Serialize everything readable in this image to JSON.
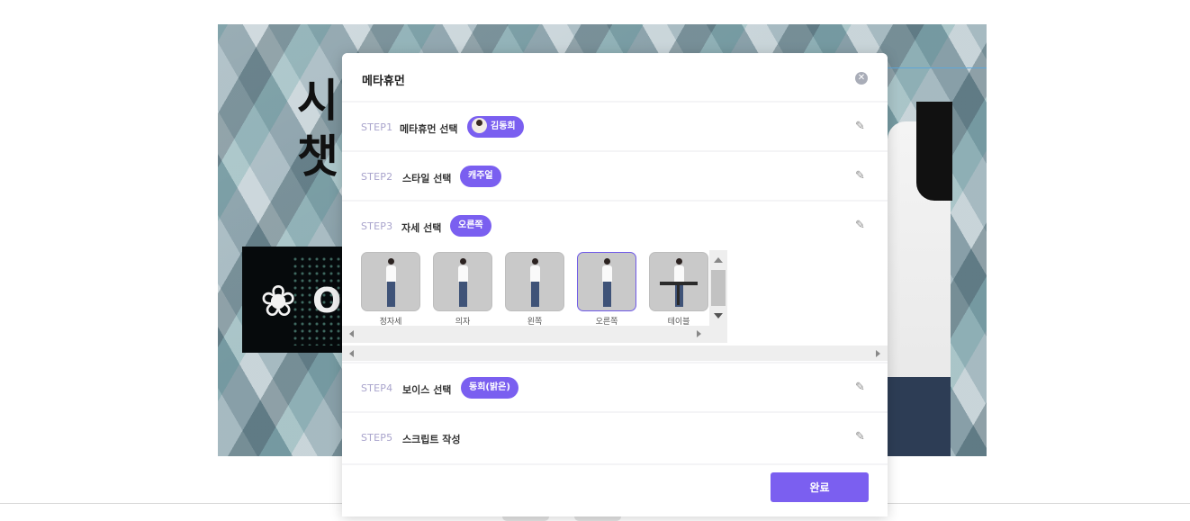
{
  "slide": {
    "title_line1": "시",
    "title_line2": "챗",
    "logo_text": "O"
  },
  "modal": {
    "title": "메타휴먼",
    "close_icon": "close-icon",
    "edit_icon": "pencil-icon",
    "steps": [
      {
        "num": "STEP1",
        "label": "메타휴먼 선택",
        "value": "김동희",
        "has_avatar": true
      },
      {
        "num": "STEP2",
        "label": "스타일 선택",
        "value": "캐주얼"
      },
      {
        "num": "STEP3",
        "label": "자세 선택",
        "value": "오른쪽"
      },
      {
        "num": "STEP4",
        "label": "보이스 선택",
        "value": "동희(밝은)"
      },
      {
        "num": "STEP5",
        "label": "스크립트 작성",
        "value": ""
      }
    ],
    "poses": [
      {
        "label": "정자세",
        "selected": false
      },
      {
        "label": "의자",
        "selected": false
      },
      {
        "label": "왼쪽",
        "selected": false
      },
      {
        "label": "오른쪽",
        "selected": true
      },
      {
        "label": "테이블",
        "selected": false
      }
    ],
    "done_label": "완료"
  },
  "colors": {
    "accent": "#7b5ff0",
    "step_number": "#a9a4cc",
    "selected_border": "#6f5ae8"
  }
}
